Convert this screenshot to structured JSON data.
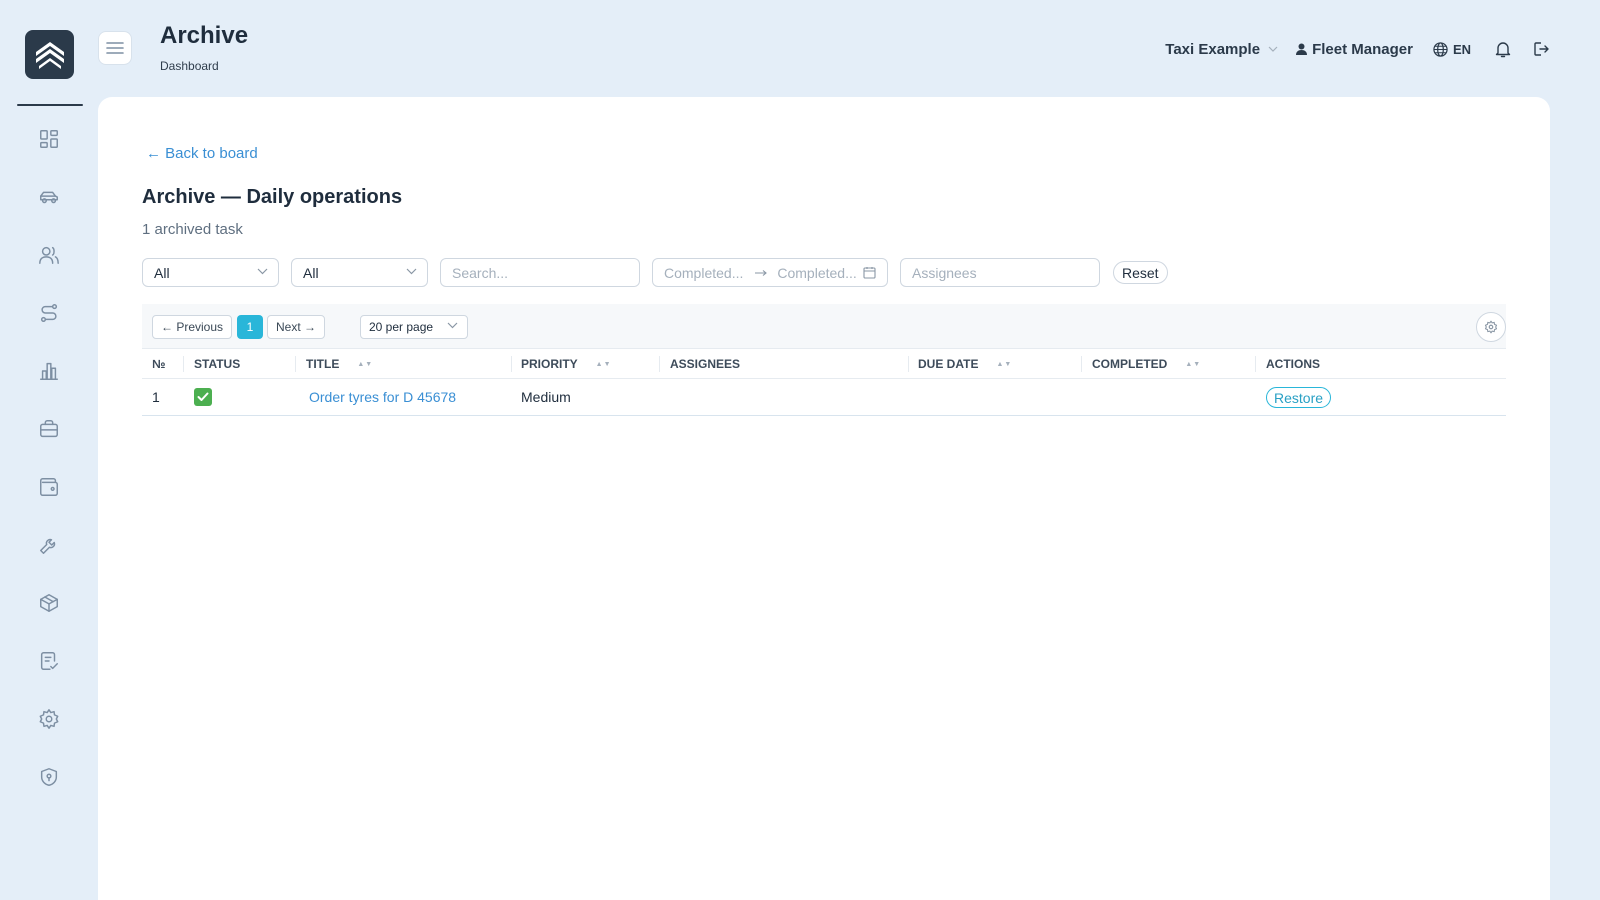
{
  "header": {
    "title": "Archive",
    "breadcrumb": "Dashboard",
    "company": "Taxi Example",
    "user": "Fleet Manager",
    "language": "EN"
  },
  "sidebar": {
    "items": [
      {
        "icon": "dashboard-icon"
      },
      {
        "icon": "car-icon"
      },
      {
        "icon": "users-icon"
      },
      {
        "icon": "route-icon"
      },
      {
        "icon": "bar-chart-icon"
      },
      {
        "icon": "briefcase-icon"
      },
      {
        "icon": "wallet-icon"
      },
      {
        "icon": "wrench-icon"
      },
      {
        "icon": "package-icon"
      },
      {
        "icon": "clipboard-check-icon"
      },
      {
        "icon": "settings-icon"
      },
      {
        "icon": "shield-icon"
      }
    ]
  },
  "main": {
    "back_link": "← Back to board",
    "title": "Archive — Daily operations",
    "count_text": "1 archived task",
    "filters": {
      "filter1_value": "All",
      "filter2_value": "All",
      "search_placeholder": "Search...",
      "completed_from_placeholder": "Completed...",
      "completed_to_placeholder": "Completed...",
      "assignees_placeholder": "Assignees",
      "reset_label": "Reset"
    },
    "pagination": {
      "previous_label": "← Previous",
      "current_page": "1",
      "next_label": "Next →",
      "per_page": "20 per page"
    },
    "table": {
      "columns": [
        "№",
        "Status",
        "Title",
        "Priority",
        "Assignees",
        "Due date",
        "Completed",
        "Actions"
      ],
      "rows": [
        {
          "number": "1",
          "status": "completed",
          "title": "Order tyres for D 45678",
          "priority": "Medium",
          "assignees": "",
          "due_date": "",
          "completed": "",
          "action_label": "Restore"
        }
      ]
    }
  },
  "colors": {
    "background": "#e4eef8",
    "accent": "#29b6d9",
    "link": "#3a8fd4",
    "status_done": "#4caf50"
  }
}
